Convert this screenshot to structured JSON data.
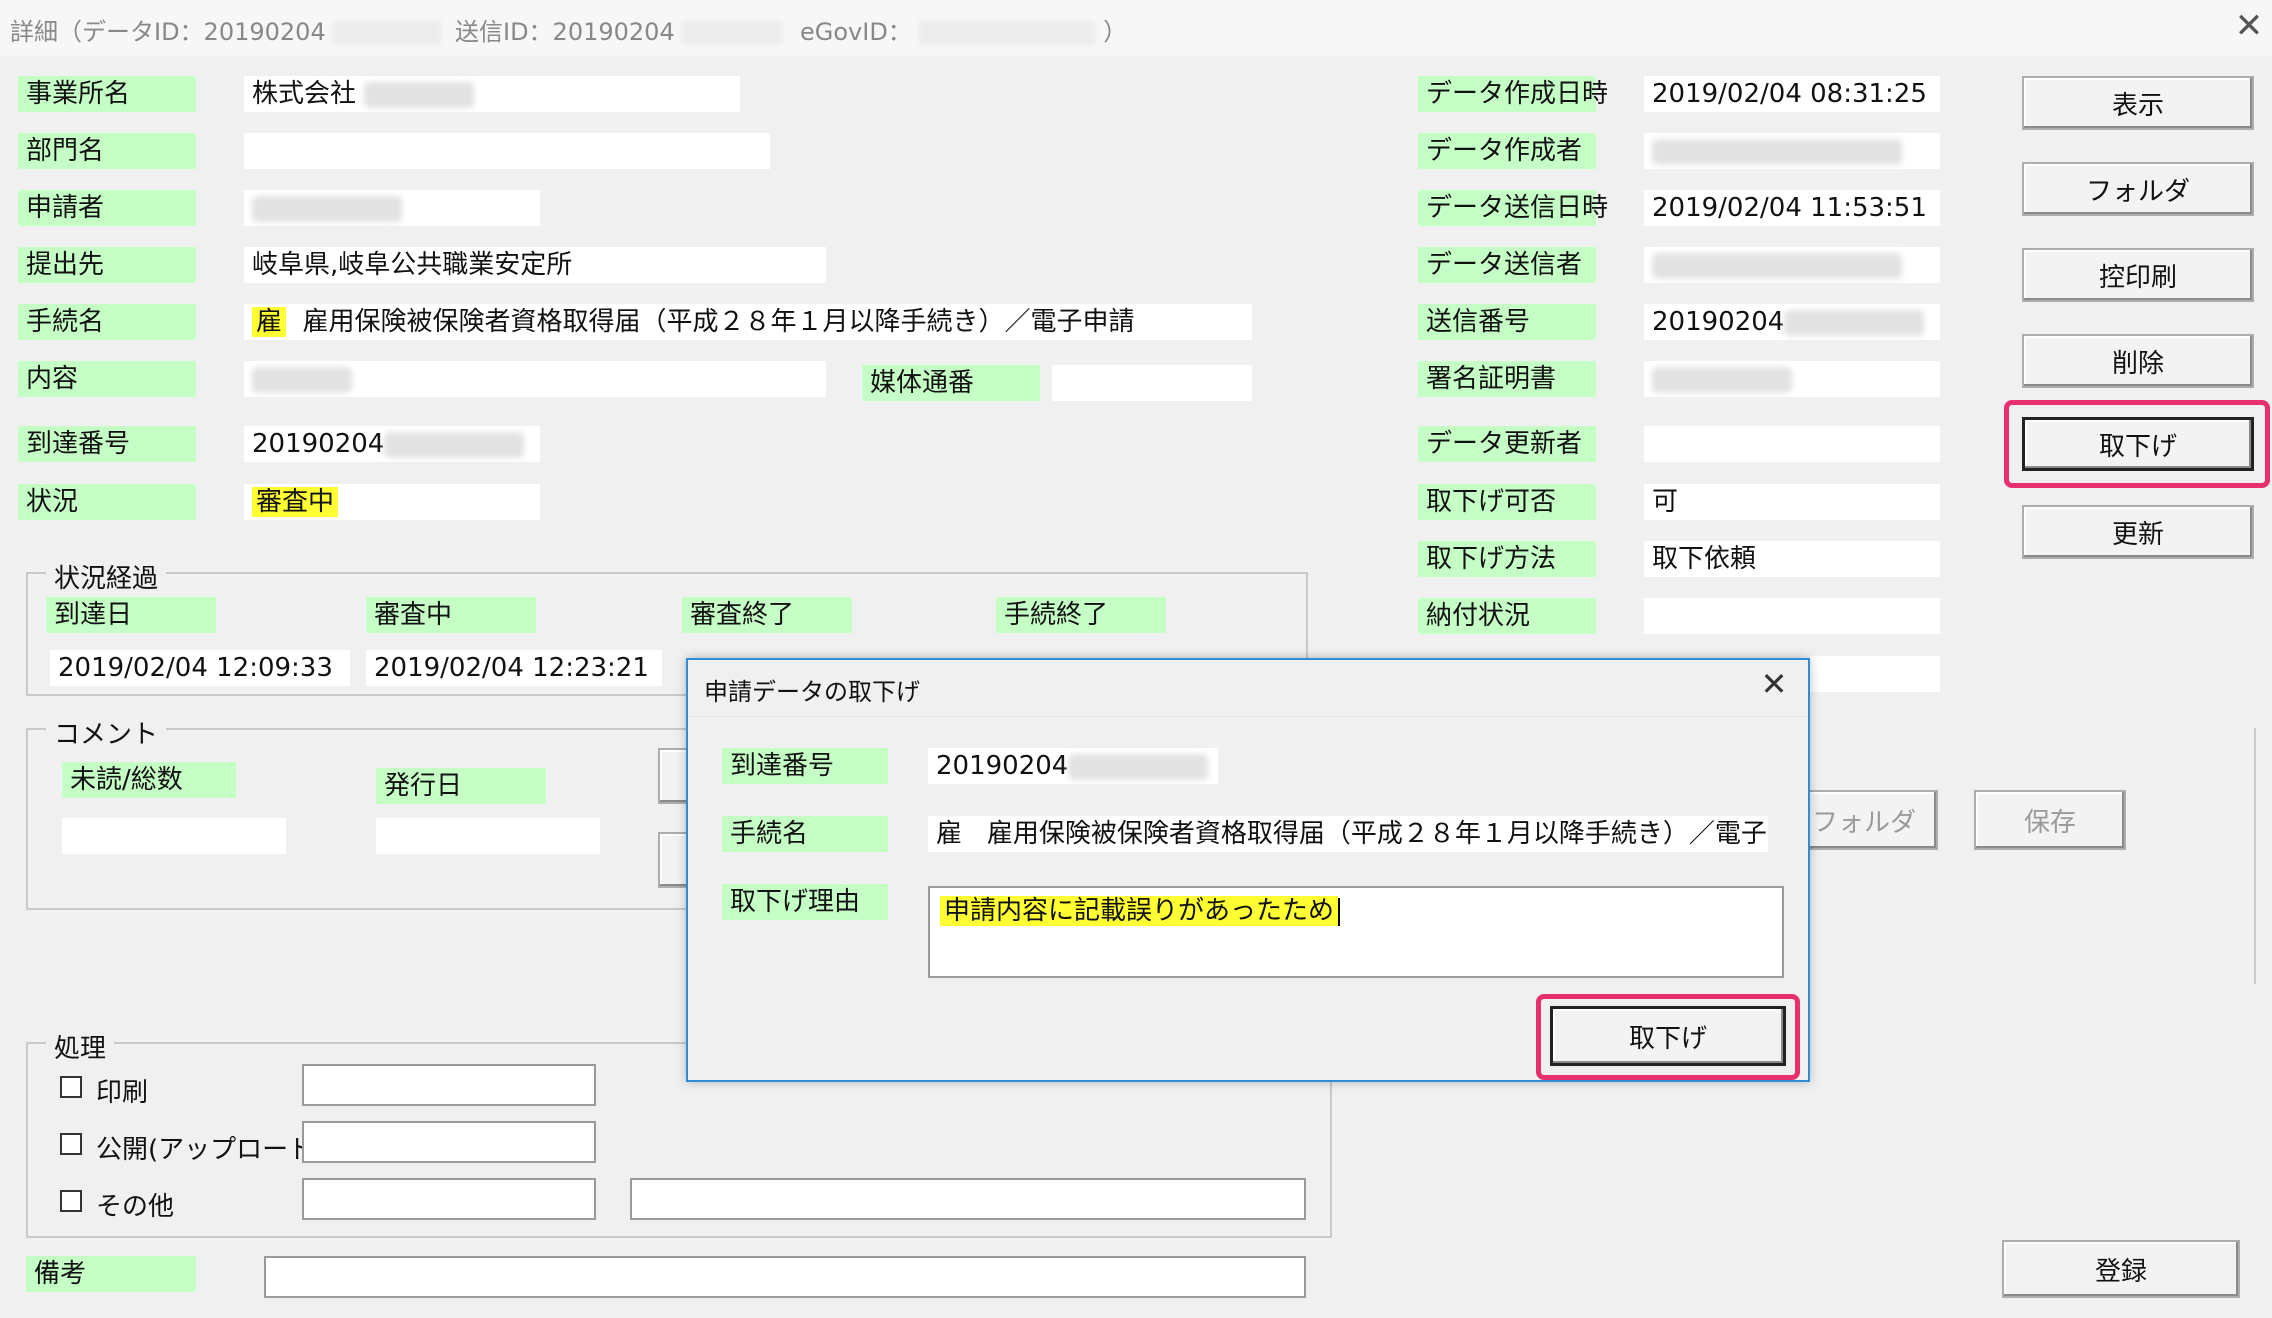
{
  "window": {
    "title_prefix": "詳細（データID：20190204",
    "send_id_label": "送信ID：20190204",
    "egov_label": "eGovID：",
    "title_suffix": "）"
  },
  "fields": {
    "office_label": "事業所名",
    "office_value": "株式会社",
    "dept_label": "部門名",
    "dept_value": "",
    "applicant_label": "申請者",
    "submit_to_label": "提出先",
    "submit_to_value": "岐阜県,岐阜公共職業安定所",
    "procedure_label": "手続名",
    "procedure_tag": "雇",
    "procedure_value": "雇用保険被保険者資格取得届（平成２８年１月以降手続き）／電子申請",
    "content_label": "内容",
    "media_label": "媒体通番",
    "arrival_no_label": "到達番号",
    "arrival_no_value": "20190204",
    "status_label": "状況",
    "status_value": "審査中"
  },
  "right_fields": {
    "created_at_label": "データ作成日時",
    "created_at_value": "2019/02/04 08:31:25",
    "created_by_label": "データ作成者",
    "sent_at_label": "データ送信日時",
    "sent_at_value": "2019/02/04 11:53:51",
    "sent_by_label": "データ送信者",
    "send_no_label": "送信番号",
    "send_no_value": "20190204",
    "cert_label": "署名証明書",
    "updated_by_label": "データ更新者",
    "withdraw_possible_label": "取下げ可否",
    "withdraw_possible_value": "可",
    "withdraw_method_label": "取下げ方法",
    "withdraw_method_value": "取下依頼",
    "payment_label": "納付状況"
  },
  "buttons": {
    "display": "表示",
    "folder": "フォルダ",
    "print_copy": "控印刷",
    "delete": "削除",
    "withdraw": "取下げ",
    "update": "更新",
    "comment_folder": "フォルダ",
    "comment_save": "保存",
    "register": "登録"
  },
  "progress": {
    "legend": "状況経過",
    "arrival_label": "到達日",
    "arrival_value": "2019/02/04 12:09:33",
    "review_label": "審査中",
    "review_value": "2019/02/04 12:23:21",
    "review_end_label": "審査終了",
    "proc_end_label": "手続終了"
  },
  "comment": {
    "legend": "コメント",
    "unread_label": "未読/総数",
    "issue_date_label": "発行日"
  },
  "processing": {
    "legend": "処理",
    "print_label": "印刷",
    "publish_label": "公開(アップロード)",
    "other_label": "その他"
  },
  "remarks_label": "備考",
  "dialog": {
    "title": "申請データの取下げ",
    "arrival_no_label": "到達番号",
    "arrival_no_value": "20190204",
    "procedure_label": "手続名",
    "procedure_tag": "雇",
    "procedure_value": "雇用保険被保険者資格取得届（平成２８年１月以降手続き）／電子",
    "reason_label": "取下げ理由",
    "reason_value": "申請内容に記載誤りがあったため",
    "withdraw_button": "取下げ"
  },
  "colors": {
    "label_bg": "#c6ffc6",
    "highlight": "#ffff33",
    "focus_ring": "#e8306e",
    "dialog_border": "#2f8bd6"
  }
}
